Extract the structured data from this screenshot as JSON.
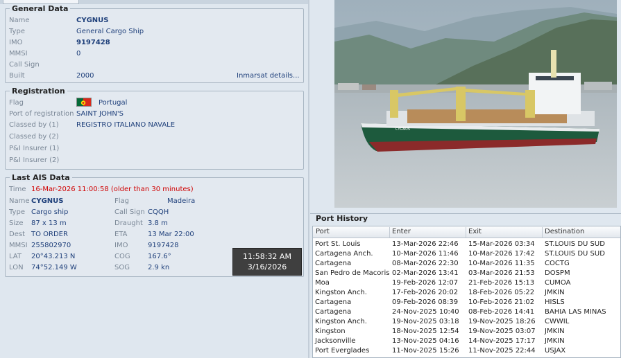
{
  "general": {
    "title": "General Data",
    "name_label": "Name",
    "name": "CYGNUS",
    "type_label": "Type",
    "type": "General Cargo Ship",
    "imo_label": "IMO",
    "imo": "9197428",
    "mmsi_label": "MMSI",
    "mmsi": "0",
    "callsign_label": "Call Sign",
    "callsign": "",
    "built_label": "Built",
    "built": "2000",
    "inmarsat_link": "Inmarsat details..."
  },
  "registration": {
    "title": "Registration",
    "flag_label": "Flag",
    "flag": "Portugal",
    "port_label": "Port of registration",
    "port": "SAINT JOHN'S",
    "classed1_label": "Classed by (1)",
    "classed1": "REGISTRO ITALIANO NAVALE",
    "classed2_label": "Classed by (2)",
    "pi1_label": "P&I Insurer (1)",
    "pi2_label": "P&I Insurer (2)"
  },
  "ais": {
    "title": "Last AIS Data",
    "time_label": "Time",
    "time": "16-Mar-2026 11:00:58 (older than 30 minutes)",
    "name_label": "Name",
    "name": "CYGNUS",
    "type_label": "Type",
    "type": "Cargo ship",
    "size_label": "Size",
    "size": "87 x 13 m",
    "dest_label": "Dest",
    "dest": "TO ORDER",
    "mmsi_label": "MMSI",
    "mmsi": "255802970",
    "lat_label": "LAT",
    "lat": "20°43.213 N",
    "lon_label": "LON",
    "lon": "74°52.149 W",
    "flag_label": "Flag",
    "flag": "Madeira",
    "callsign_label": "Call Sign",
    "callsign": "CQQH",
    "draught_label": "Draught",
    "draught": "3.8 m",
    "eta_label": "ETA",
    "eta": "13 Mar 22:00",
    "imo_label": "IMO",
    "imo": "9197428",
    "cog_label": "COG",
    "cog": "167.6°",
    "sog_label": "SOG",
    "sog": "2.9 kn"
  },
  "clock": {
    "time": "11:58:32 AM",
    "date": "3/16/2026"
  },
  "photo": {
    "hull_name": "CYGNUS"
  },
  "port_history": {
    "title": "Port History",
    "columns": [
      "Port",
      "Enter",
      "Exit",
      "Destination"
    ],
    "rows": [
      [
        "Port St. Louis",
        "13-Mar-2026 22:46",
        "15-Mar-2026 03:34",
        "ST.LOUIS DU SUD"
      ],
      [
        "Cartagena Anch.",
        "10-Mar-2026 11:46",
        "10-Mar-2026 17:42",
        "ST.LOUIS DU SUD"
      ],
      [
        "Cartagena",
        "08-Mar-2026 22:30",
        "10-Mar-2026 11:35",
        "COCTG"
      ],
      [
        "San Pedro de Macoris",
        "02-Mar-2026 13:41",
        "03-Mar-2026 21:53",
        "DOSPM"
      ],
      [
        "Moa",
        "19-Feb-2026 12:07",
        "21-Feb-2026 15:13",
        "CUMOA"
      ],
      [
        "Kingston Anch.",
        "17-Feb-2026 20:02",
        "18-Feb-2026 05:22",
        "JMKIN"
      ],
      [
        "Cartagena",
        "09-Feb-2026 08:39",
        "10-Feb-2026 21:02",
        "HISLS"
      ],
      [
        "Cartagena",
        "24-Nov-2025 10:40",
        "08-Feb-2026 14:41",
        "BAHIA LAS MINAS"
      ],
      [
        "Kingston Anch.",
        "19-Nov-2025 03:18",
        "19-Nov-2025 18:26",
        "CWWIL"
      ],
      [
        "Kingston",
        "18-Nov-2025 12:54",
        "19-Nov-2025 03:07",
        "JMKIN"
      ],
      [
        "Jacksonville",
        "13-Nov-2025 04:16",
        "14-Nov-2025 17:17",
        "JMKIN"
      ],
      [
        "Port Everglades",
        "11-Nov-2025 15:26",
        "11-Nov-2025 22:44",
        "USJAX"
      ]
    ]
  }
}
